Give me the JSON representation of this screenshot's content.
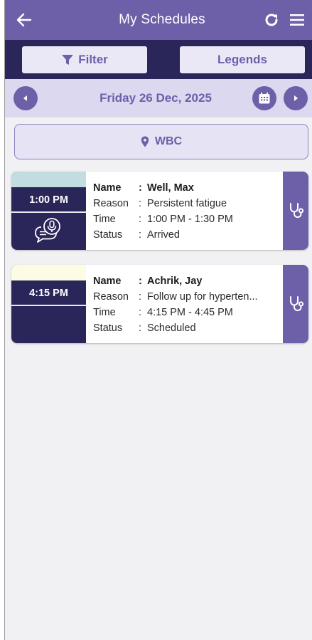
{
  "header": {
    "title": "My Schedules"
  },
  "toolbar": {
    "filter_label": "Filter",
    "legends_label": "Legends"
  },
  "date_bar": {
    "date": "Friday 26 Dec, 2025"
  },
  "location": {
    "name": "WBC"
  },
  "appointments": [
    {
      "time": "1:00 PM",
      "strip_color": "#c2dde0",
      "name_label": "Name",
      "name": "Well, Max",
      "reason_label": "Reason",
      "reason": "Persistent fatigue",
      "time_label": "Time",
      "time_range": "1:00 PM - 1:30 PM",
      "status_label": "Status",
      "status": "Arrived",
      "has_audio_note": true
    },
    {
      "time": "4:15 PM",
      "strip_color": "#fcfbe3",
      "name_label": "Name",
      "name": "Achrik, Jay",
      "reason_label": "Reason",
      "reason": "Follow up for hyperten...",
      "time_label": "Time",
      "time_range": "4:15 PM - 4:45 PM",
      "status_label": "Status",
      "status": "Scheduled",
      "has_audio_note": false
    }
  ],
  "separator": ":",
  "colors": {
    "primary": "#6e5fa9",
    "dark": "#2a2659",
    "light": "#dcd8ef"
  },
  "icons": [
    "back-arrow-icon",
    "refresh-icon",
    "menu-icon",
    "filter-icon",
    "chevron-left-icon",
    "calendar-icon",
    "chevron-right-icon",
    "location-pin-icon",
    "audio-note-icon",
    "stethoscope-icon"
  ]
}
